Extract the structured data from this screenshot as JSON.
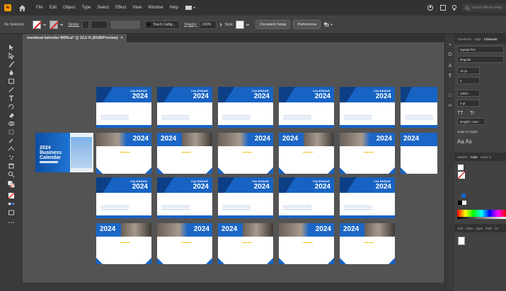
{
  "menubar": {
    "logo": "Ai",
    "items": [
      "File",
      "Edit",
      "Object",
      "Type",
      "Select",
      "Effect",
      "View",
      "Window",
      "Help"
    ],
    "search_placeholder": "Search Adobe Help"
  },
  "controlbar": {
    "selection_label": "No Selection",
    "stroke_label": "Stroke:",
    "brush_label": "Touch Callig...",
    "opacity_label": "Opacity:",
    "opacity_value": "100%",
    "style_label": "Style:",
    "document_setup": "Document Setup",
    "preferences": "Preferences"
  },
  "document": {
    "tab_title": "membuat kalender MDN.ai* @ 12,5 % (RGB/Preview)",
    "close": "×"
  },
  "artboards": {
    "calendar_word": "CALENDAR",
    "year": "2024",
    "cover_title_line1": "2024",
    "cover_title_line2": "Business",
    "cover_title_line3": "Calendar"
  },
  "rpanel": {
    "tabs": [
      "Transform",
      "Align",
      "Character"
    ],
    "font_family": "Myriad Pro",
    "font_style": "Regular",
    "font_size": "12 pt",
    "leading": "0",
    "scale": "100%",
    "tracking": "0 pt",
    "tt_a": "TT",
    "tt_b": "Tr",
    "language": "English: USA",
    "snap": "Snap to Glyph",
    "color_tabs": [
      "Swatch",
      "Color",
      "Color G"
    ],
    "bottom_tabs": [
      "Artb",
      "Libra",
      "Appe",
      "Path",
      "Gr"
    ]
  },
  "colors": {
    "accent_blue": "#1763c4",
    "dark_blue": "#0c3f86",
    "panel_bg": "#424242",
    "canvas_bg": "#535353"
  }
}
